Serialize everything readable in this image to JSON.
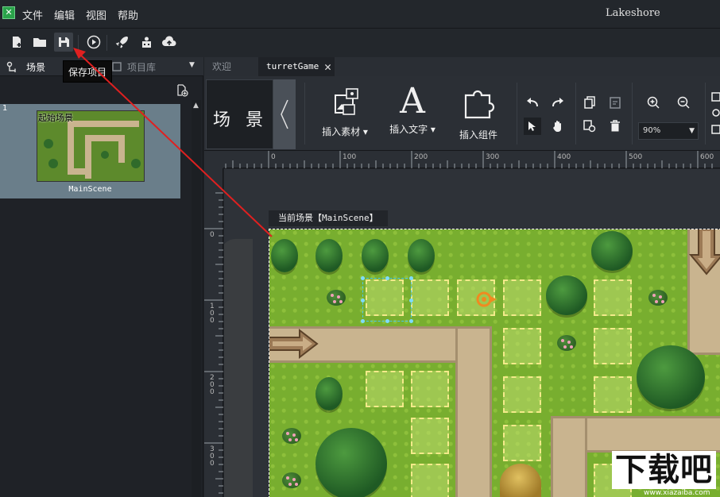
{
  "titlebar": {
    "app_title": "Lakeshore",
    "menus": [
      "文件",
      "编辑",
      "视图",
      "帮助"
    ]
  },
  "toolbar": {
    "tooltip": "保存项目"
  },
  "left_panel": {
    "tabs": [
      "场景",
      "项目库"
    ],
    "scenes": [
      {
        "index": "1",
        "thumb_label": "起始场景",
        "name": "MainScene"
      }
    ]
  },
  "doc_tabs": {
    "inactive": "欢迎",
    "active": "turretGame"
  },
  "ribbon": {
    "scene_label": "场 景",
    "insert_material": "插入素材",
    "insert_text": "插入文字",
    "insert_component": "插入组件",
    "zoom": "90%"
  },
  "rulers": {
    "h_labels": [
      "0",
      "100",
      "200",
      "300",
      "400",
      "500",
      "600"
    ],
    "v_labels": [
      "0",
      "100",
      "200",
      "300"
    ]
  },
  "canvas": {
    "scene_caption": "当前场景【MainScene】"
  },
  "watermark": {
    "big": "下载吧",
    "small": "www.xiazaiba.com"
  },
  "colors": {
    "app_bg": "#1f2227",
    "panel_bg": "#2b2f35",
    "selected_scene": "#6a7e8a",
    "grass": "#78ae2f",
    "annotation_arrow": "#e02020"
  }
}
